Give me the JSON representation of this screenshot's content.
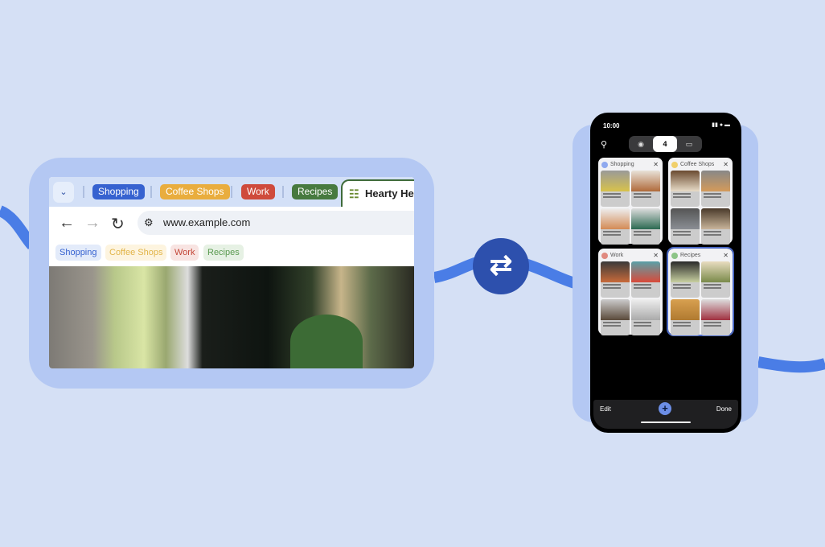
{
  "colors": {
    "background": "#d5e0f5",
    "panel": "#b4c8f3",
    "wave": "#4a7de6",
    "sync_button": "#2d50ad",
    "shopping": "#3662d0",
    "coffee": "#e9ad3e",
    "work": "#cf4b3c",
    "recipes": "#477a3f"
  },
  "desktop": {
    "tab_groups": [
      {
        "label": "Shopping"
      },
      {
        "label": "Coffee Shops"
      },
      {
        "label": "Work"
      },
      {
        "label": "Recipes"
      }
    ],
    "active_tab": {
      "title": "Hearty Herb",
      "icon": "recipe-signpost-icon"
    },
    "url": "www.example.com",
    "bookmarks": [
      {
        "label": "Shopping"
      },
      {
        "label": "Coffee Shops"
      },
      {
        "label": "Work"
      },
      {
        "label": "Recipes"
      }
    ]
  },
  "sync_icon": "swap-arrows-icon",
  "phone": {
    "time": "10:00",
    "tab_count": "4",
    "groups": [
      {
        "label": "Shopping"
      },
      {
        "label": "Coffee Shops"
      },
      {
        "label": "Work"
      },
      {
        "label": "Recipes"
      }
    ],
    "selected_group": "Recipes",
    "edit_label": "Edit",
    "done_label": "Done",
    "add_label": "+"
  }
}
